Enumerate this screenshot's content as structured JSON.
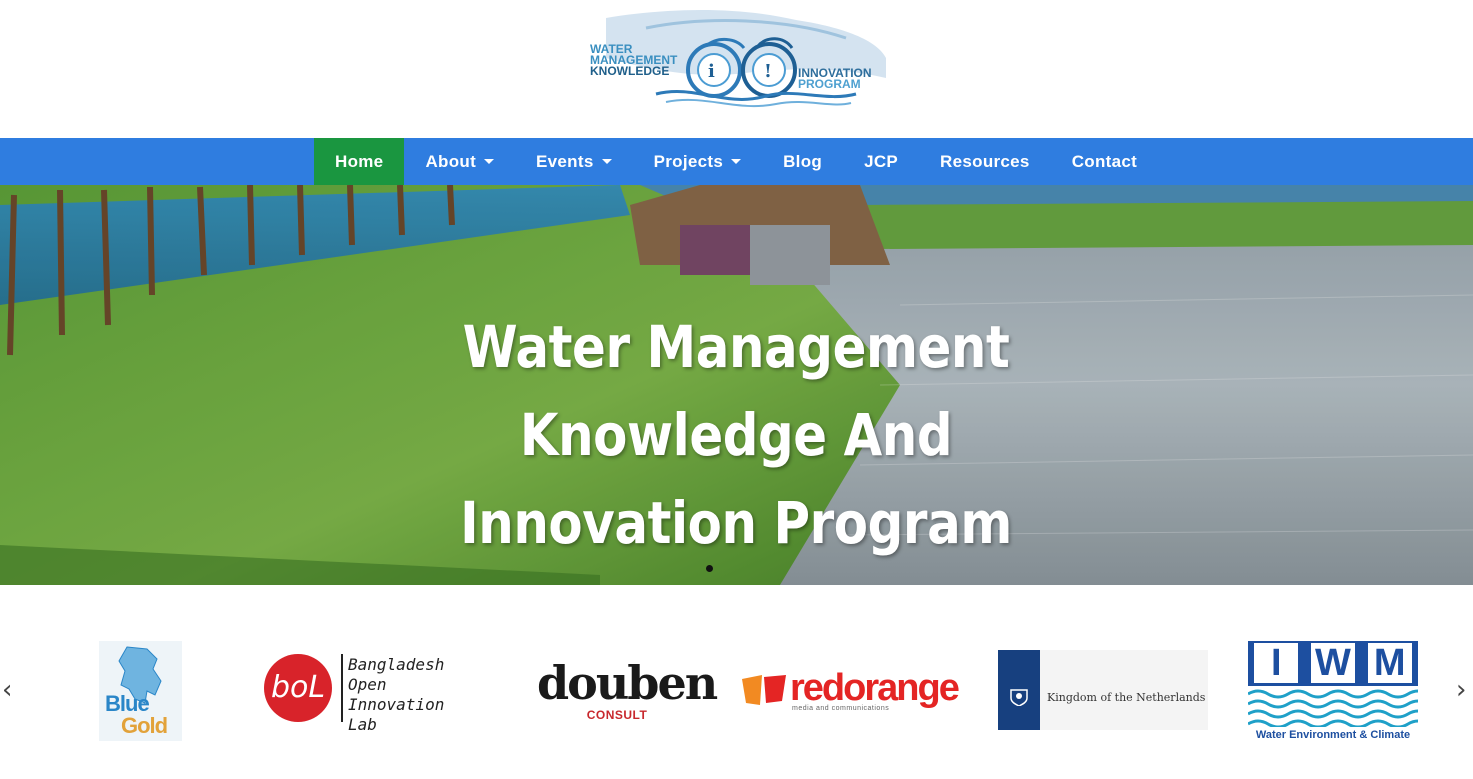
{
  "logo": {
    "lines_left": [
      "WATER",
      "MANAGEMENT",
      "KNOWLEDGE"
    ],
    "lines_right": [
      "INNOVATION",
      "PROGRAM"
    ],
    "letters": [
      "i",
      "!"
    ],
    "icon": "wave-logo-icon"
  },
  "nav": {
    "items": [
      {
        "label": "Home",
        "active": true,
        "dropdown": false
      },
      {
        "label": "About",
        "active": false,
        "dropdown": true
      },
      {
        "label": "Events",
        "active": false,
        "dropdown": true
      },
      {
        "label": "Projects",
        "active": false,
        "dropdown": true
      },
      {
        "label": "Blog",
        "active": false,
        "dropdown": false
      },
      {
        "label": "JCP",
        "active": false,
        "dropdown": false
      },
      {
        "label": "Resources",
        "active": false,
        "dropdown": false
      },
      {
        "label": "Contact",
        "active": false,
        "dropdown": false
      }
    ],
    "bg_color": "#2f7de0",
    "active_color": "#1a9640"
  },
  "hero": {
    "title_line1": "Water Management Knowledge And",
    "title_line2": "Innovation Program"
  },
  "partners": {
    "prev_icon": "chevron-left-icon",
    "next_icon": "chevron-right-icon",
    "bluegold": {
      "word1": "Blue",
      "word2": "Gold"
    },
    "bol": {
      "mark": "boL",
      "lines": [
        "Bangladesh",
        "Open Innovation",
        "Lab"
      ]
    },
    "douben": {
      "name": "douben",
      "sub": "CONSULT"
    },
    "redorange": {
      "name": "redorange",
      "sub": "media and communications"
    },
    "netherlands": {
      "text": "Kingdom of the Netherlands"
    },
    "iwm": {
      "letters": [
        "I",
        "W",
        "M"
      ],
      "caption": "Water Environment & Climate"
    }
  }
}
